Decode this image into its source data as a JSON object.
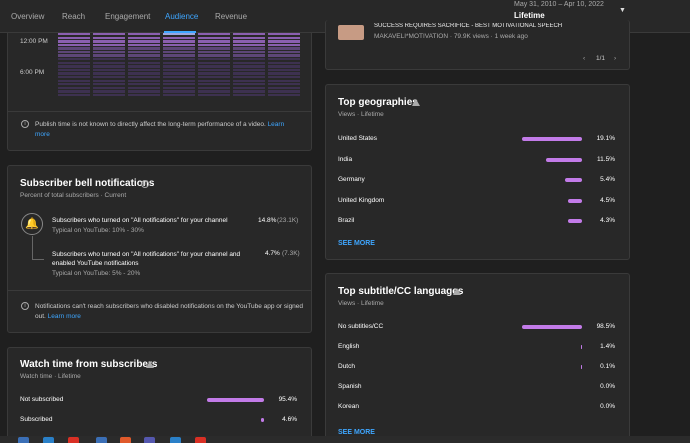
{
  "nav": {
    "tabs": [
      "Overview",
      "Reach",
      "Engagement",
      "Audience",
      "Revenue"
    ],
    "active_tab": "Audience",
    "date_range_small": "May 31, 2010 – Apr 10, 2022",
    "date_range_label": "Lifetime"
  },
  "publish_time": {
    "time_labels": [
      "12:00 PM",
      "6:00 PM"
    ],
    "note": "Publish time is not known to directly affect the long-term performance of a video.",
    "learn_more": "Learn more"
  },
  "bell": {
    "title": "Subscriber bell notifications",
    "subtitle": "Percent of total subscribers · Current",
    "rows": [
      {
        "label": "Subscribers who turned on \"All notifications\" for your channel",
        "typical": "Typical on YouTube: 10% - 30%",
        "percent": "14.8%",
        "count": "(23.1K)"
      },
      {
        "label": "Subscribers who turned on \"All notifications\" for your channel and enabled YouTube notifications",
        "typical": "Typical on YouTube: 5% - 20%",
        "percent": "4.7%",
        "count": "(7.3K)"
      }
    ],
    "note": "Notifications can't reach subscribers who disabled notifications on the YouTube app or signed out.",
    "learn_more": "Learn more"
  },
  "watch_time": {
    "title": "Watch time from subscribers",
    "subtitle": "Watch time · Lifetime",
    "rows": [
      {
        "label": "Not subscribed",
        "value": "95.4%",
        "fraction": 0.954
      },
      {
        "label": "Subscribed",
        "value": "4.6%",
        "fraction": 0.046
      }
    ]
  },
  "top_video": {
    "title": "SUCCESS REQUIRES SACRIFICE - BEST MOTIVATIONAL SPEECH",
    "meta": "MAKAVELI*MOTIVATION · 79.9K views · 1 week ago",
    "pagination": "1/1"
  },
  "geographies": {
    "title": "Top geographies",
    "subtitle": "Views · Lifetime",
    "rows": [
      {
        "label": "United States",
        "value": "19.1%",
        "fraction": 1.0
      },
      {
        "label": "India",
        "value": "11.5%",
        "fraction": 0.6
      },
      {
        "label": "Germany",
        "value": "5.4%",
        "fraction": 0.28
      },
      {
        "label": "United Kingdom",
        "value": "4.5%",
        "fraction": 0.24
      },
      {
        "label": "Brazil",
        "value": "4.3%",
        "fraction": 0.23
      }
    ],
    "see_more": "SEE MORE"
  },
  "subtitles": {
    "title": "Top subtitle/CC languages",
    "subtitle": "Views · Lifetime",
    "rows": [
      {
        "label": "No subtitles/CC",
        "value": "98.5%",
        "fraction": 1.0
      },
      {
        "label": "English",
        "value": "1.4%",
        "fraction": 0.014
      },
      {
        "label": "Dutch",
        "value": "0.1%",
        "fraction": 0.001
      },
      {
        "label": "Spanish",
        "value": "0.0%",
        "fraction": 0.0
      },
      {
        "label": "Korean",
        "value": "0.0%",
        "fraction": 0.0
      }
    ],
    "see_more": "SEE MORE"
  },
  "colors": {
    "accent": "#3ea6ff",
    "bar": "#c27be8",
    "background": "#1f1f1f",
    "card": "#282828"
  }
}
